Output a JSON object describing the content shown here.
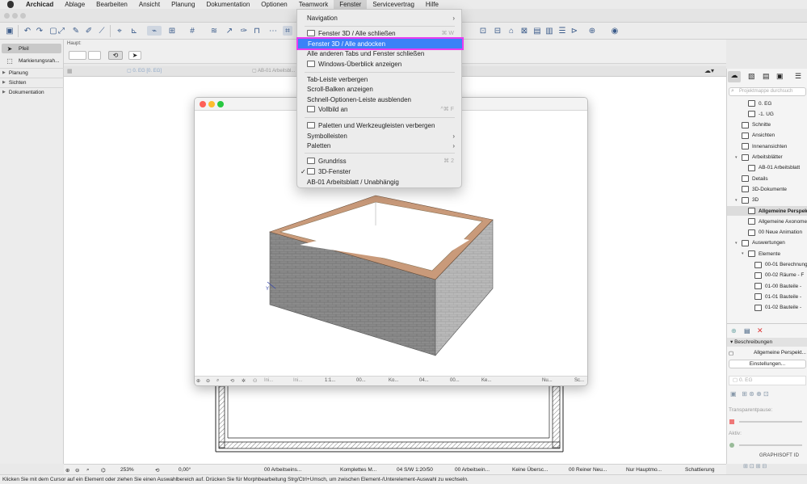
{
  "menubar": {
    "app": "Archicad",
    "items": [
      "Ablage",
      "Bearbeiten",
      "Ansicht",
      "Planung",
      "Dokumentation",
      "Optionen",
      "Teamwork",
      "Fenster",
      "Servicevertrag",
      "Hilfe"
    ],
    "active": "Fenster"
  },
  "fenster_menu": {
    "navigation": "Navigation",
    "close3d": "Fenster 3D / Alle schließen",
    "close3d_shortcut": "⌘ W",
    "dock": "Fenster 3D / Alle andocken",
    "close_tabs": "Alle anderen Tabs und Fenster schließen",
    "overview": "Windows-Überblick anzeigen",
    "hide_tabbar": "Tab-Leiste verbergen",
    "scrollbars": "Scroll-Balken anzeigen",
    "quick_options": "Schnell-Optionen-Leiste ausblenden",
    "fullscreen": "Vollbild an",
    "fullscreen_shortcut": "^⌘ F",
    "hide_palettes": "Paletten und Werkzeugleisten verbergen",
    "toolbars": "Symbolleisten",
    "palettes": "Paletten",
    "floorplan": "Grundriss",
    "floorplan_shortcut": "⌘ 2",
    "window3d": "3D-Fenster",
    "window3d_check": "✓",
    "worksheet": "AB-01 Arbeitsblatt / Unabhängig"
  },
  "infobox": {
    "label": "Haupt:"
  },
  "toolbox": {
    "tools": [
      "Pfeil",
      "Markierungsrah..."
    ],
    "sections": [
      "Planung",
      "Sichten",
      "Dokumentation"
    ]
  },
  "tabs": {
    "tab1": "0. EG [0. EG]",
    "tab2": "AB-01 Arbeitsbl..."
  },
  "window3d": {
    "bottom": [
      "Ini...",
      "Ini...",
      "1:1...",
      "00...",
      "Ko...",
      "04...",
      "00...",
      "Ke...",
      "Nu...",
      "Sc..."
    ]
  },
  "navigator": {
    "search_placeholder": "Projektmappe durchsuch",
    "rows": [
      {
        "label": "0. EG",
        "indent": 3
      },
      {
        "label": "-1. UG",
        "indent": 3
      },
      {
        "label": "Schnitte",
        "indent": 2
      },
      {
        "label": "Ansichten",
        "indent": 2
      },
      {
        "label": "Innenansichten",
        "indent": 2
      },
      {
        "label": "Arbeitsblätter",
        "indent": 2,
        "open": true
      },
      {
        "label": "AB-01 Arbeitsblatt",
        "indent": 3
      },
      {
        "label": "Details",
        "indent": 2
      },
      {
        "label": "3D-Dokumente",
        "indent": 2
      },
      {
        "label": "3D",
        "indent": 2,
        "open": true
      },
      {
        "label": "Allgemeine Perspektive",
        "indent": 3,
        "selected": true
      },
      {
        "label": "Allgemeine Axonometrie",
        "indent": 3
      },
      {
        "label": "00 Neue Animation",
        "indent": 3
      },
      {
        "label": "Auswertungen",
        "indent": 2,
        "open": true
      },
      {
        "label": "Elemente",
        "indent": 3,
        "open": true
      },
      {
        "label": "00-01 Berechnung",
        "indent": 4
      },
      {
        "label": "00-02 Räume - F",
        "indent": 4
      },
      {
        "label": "01-00 Bauteile -",
        "indent": 4
      },
      {
        "label": "01-01 Bauteile -",
        "indent": 4
      },
      {
        "label": "01-02 Bauteile -",
        "indent": 4
      }
    ],
    "descriptions": "Beschreibungen",
    "desc_value": "Allgemeine Perspekt...",
    "settings": "Einstellungen...",
    "floor": "0. EG",
    "transparent": "Transparentpause:",
    "active": "Aktiv:",
    "brand": "GRAPHISOFT ID"
  },
  "viewbar": {
    "zoom": "253%",
    "angle": "0,00°",
    "items": [
      "00 Arbeitseins...",
      "Komplettes M...",
      "04 S/W 1:20/50",
      "00 Arbeitsein...",
      "Keine Übersc...",
      "00 Reiner Neu...",
      "Nur Hauptmo...",
      "Schattierung"
    ]
  },
  "status": "Klicken Sie mit dem Cursor auf ein Element oder ziehen Sie einen Auswahlbereich auf. Drücken Sie für Morphbearbeitung Strg/Ctrl+Umsch, um zwischen Element-/Unterelement-Auswahl zu wechseln."
}
